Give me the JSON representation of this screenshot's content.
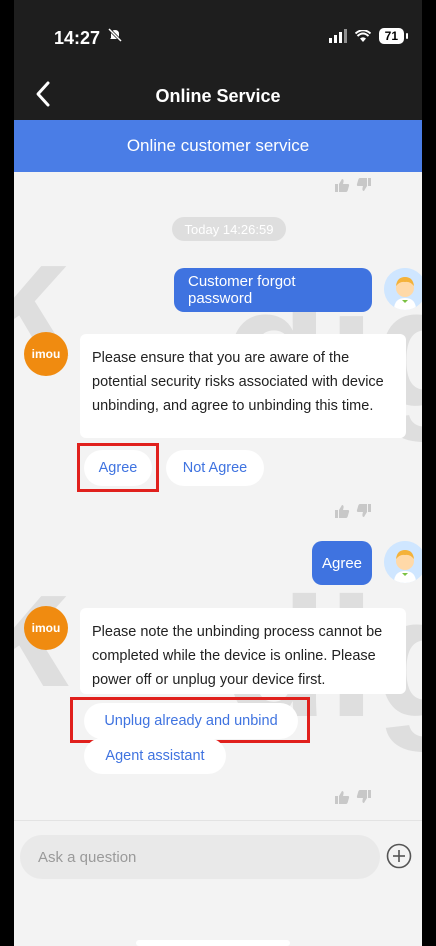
{
  "status": {
    "time": "14:27",
    "battery": "71"
  },
  "header": {
    "title": "Online Service"
  },
  "banner": {
    "label": "Online customer service"
  },
  "chat": {
    "timestamp": "Today 14:26:59",
    "user_msg_1": "Customer forgot password",
    "bot_msg_1": "Please ensure that you are aware of the potential security risks associated with device unbinding, and agree to unbinding this time.",
    "option_agree": "Agree",
    "option_not_agree": "Not Agree",
    "user_msg_2": "Agree",
    "bot_msg_2": "Please note the unbinding process cannot be completed while the device is online. Please power off or unplug your device first.",
    "option_unplug": "Unplug already and unbind",
    "option_agent": "Agent assistant",
    "bot_avatar_label": "imou"
  },
  "input": {
    "placeholder": "Ask a question"
  },
  "icons": {
    "back": "chevron-left-icon",
    "mute": "bell-slash-icon",
    "add": "plus-circle-icon",
    "like": "thumbs-up-icon",
    "dislike": "thumbs-down-icon"
  },
  "colors": {
    "accent": "#3f73e0",
    "banner": "#4a7de6",
    "highlight": "#e0201c",
    "brand": "#f08b10"
  }
}
